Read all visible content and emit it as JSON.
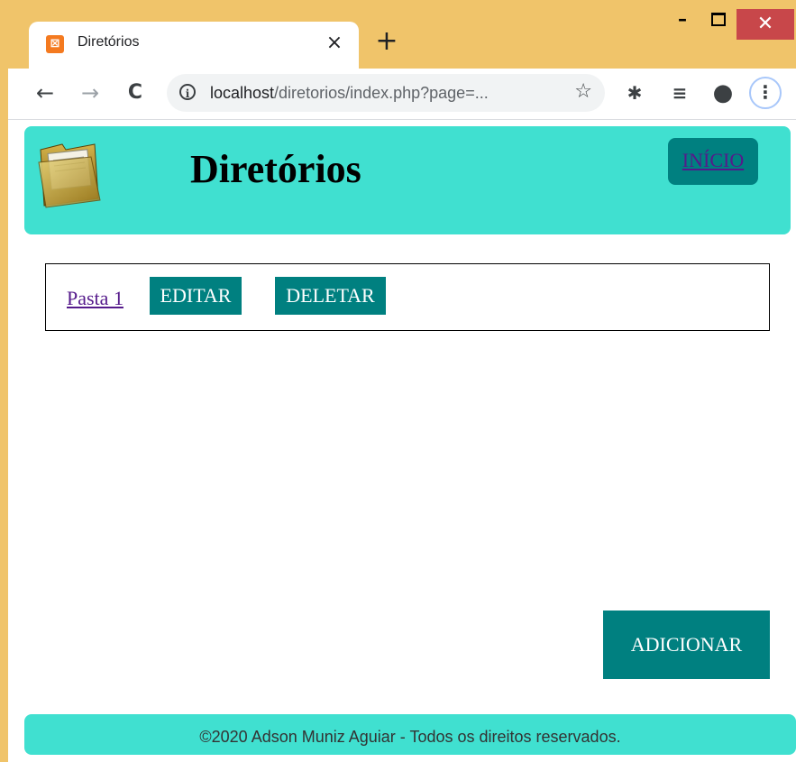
{
  "browser": {
    "tab_title": "Diretórios",
    "tab_close": "×",
    "new_tab": "+",
    "window_controls": {
      "minimize": "–",
      "close": "✕"
    },
    "toolbar": {
      "back": "←",
      "forward": "→",
      "reload": "C",
      "info": "i",
      "url_host": "localhost",
      "url_path": "/diretorios/index.php?page=...",
      "bookmark": "☆",
      "extensions": "✱",
      "media": "≡",
      "profile": "●",
      "menu": "⋮"
    },
    "icons": {
      "favicon": "xampp-icon",
      "info": "info-icon",
      "bookmark": "star-icon",
      "extensions": "puzzle-icon",
      "media": "playlist-icon",
      "profile": "account-icon",
      "menu": "kebab-menu-icon"
    }
  },
  "page": {
    "header": {
      "title": "Diretórios",
      "home_link": "INÍCIO",
      "logo_icon": "folder-icon",
      "background": "#40e0d0"
    },
    "folders": [
      {
        "name": "Pasta 1",
        "edit_label": "EDITAR",
        "delete_label": "DELETAR"
      }
    ],
    "add_label": "ADICIONAR",
    "footer": "©2020 Adson Muniz Aguiar - Todos os direitos reservados.",
    "colors": {
      "accent": "#008080",
      "header_bg": "#40e0d0",
      "link": "#551a8b"
    }
  }
}
